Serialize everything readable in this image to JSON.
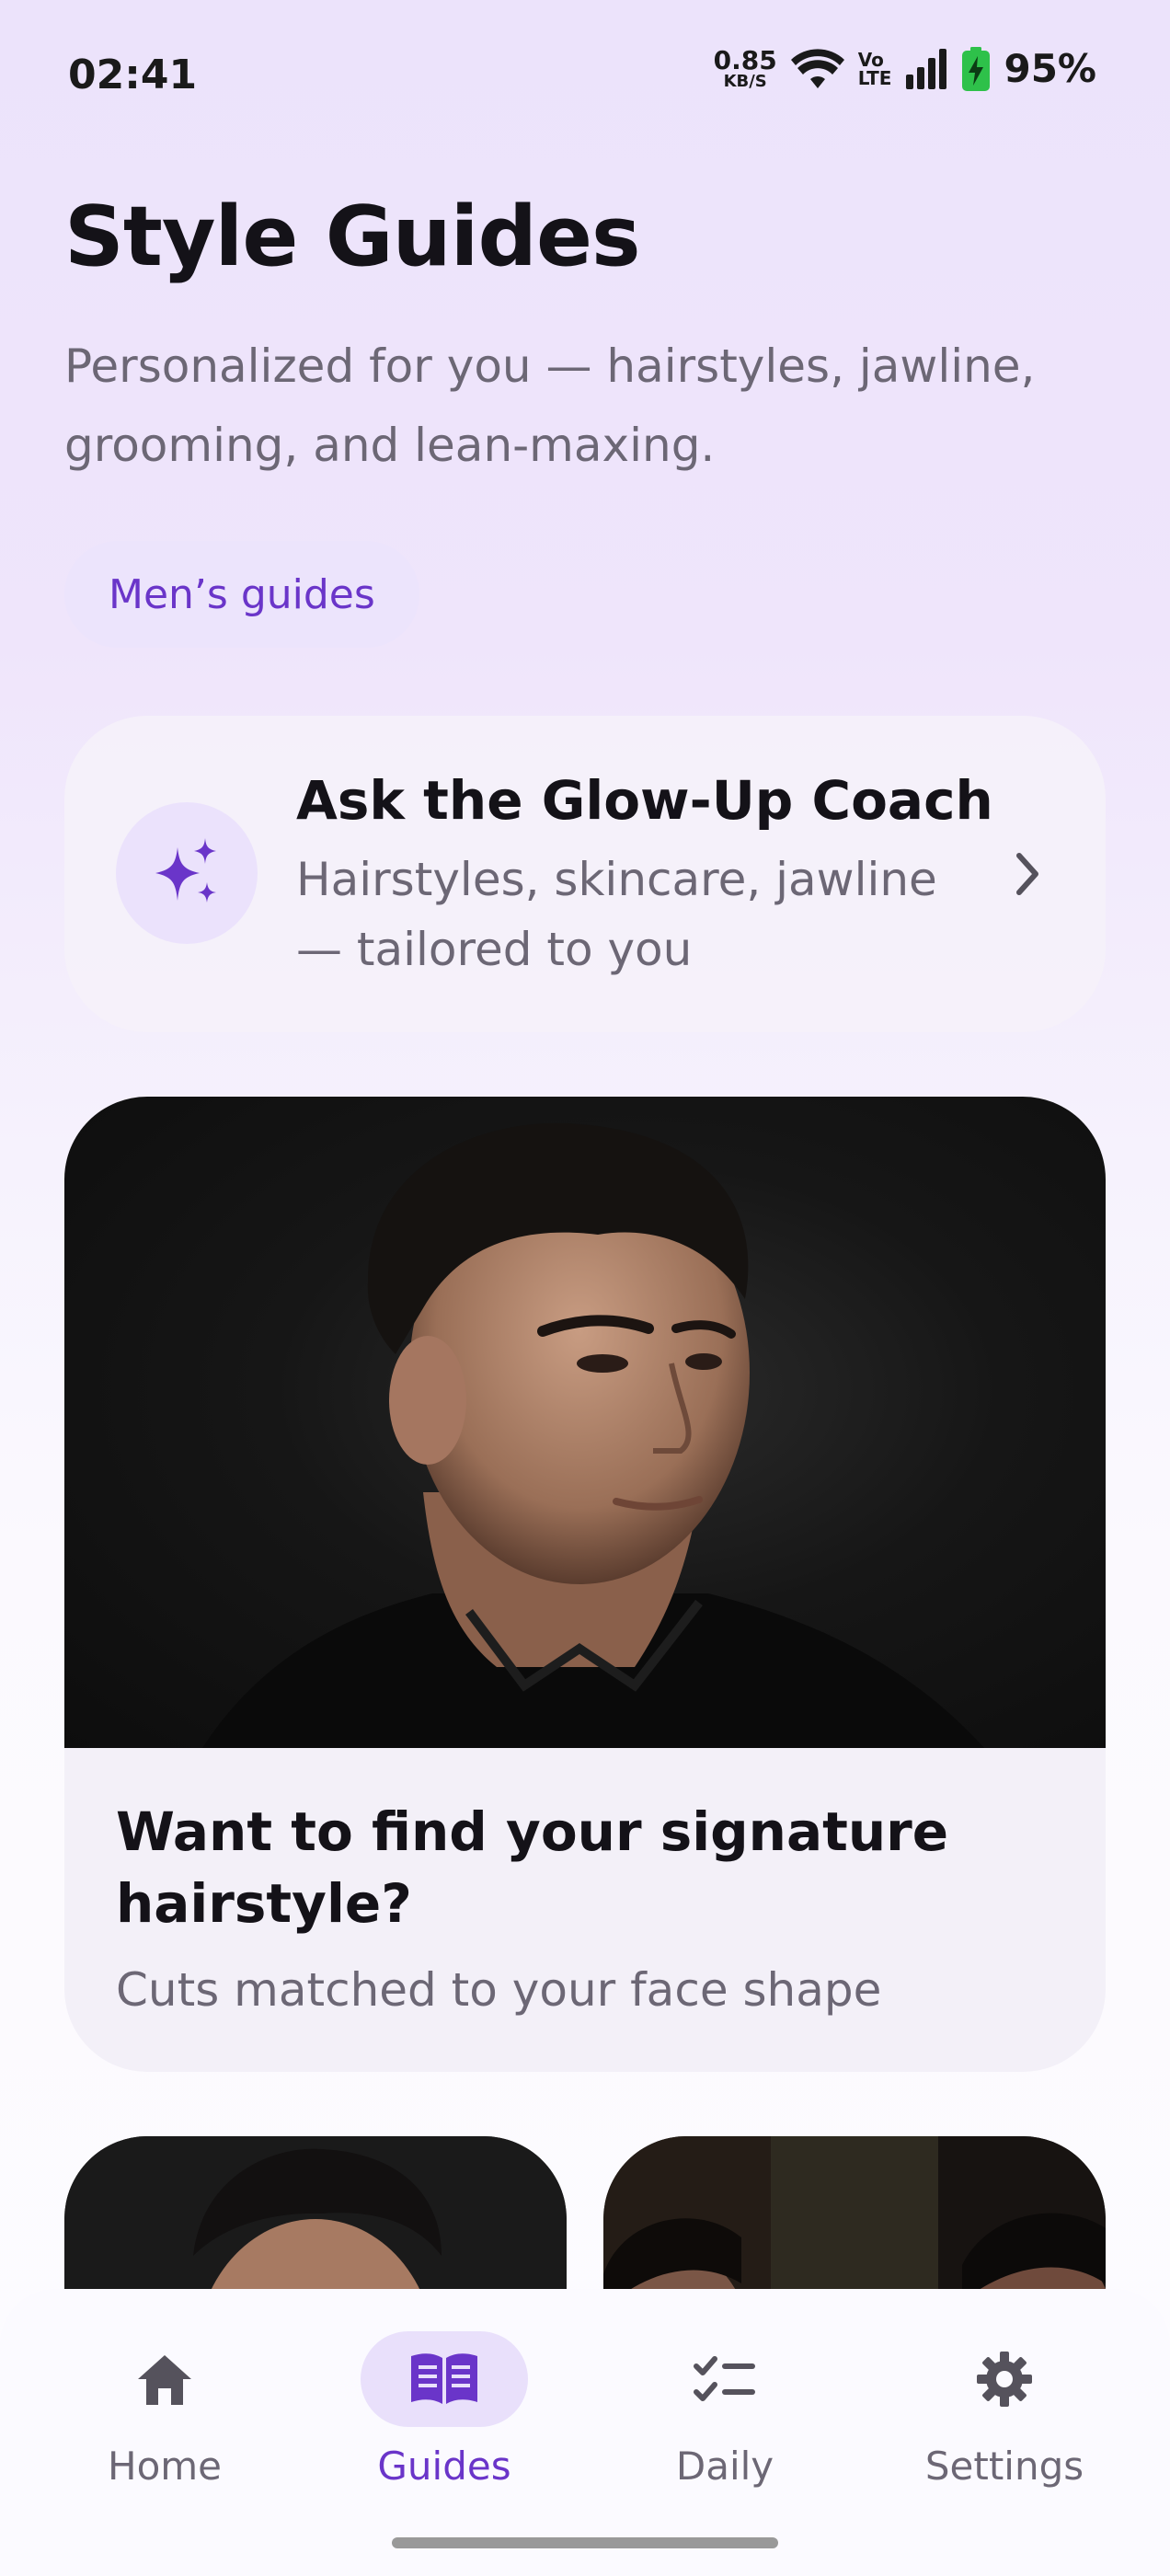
{
  "status_bar": {
    "time": "02:41",
    "net_speed_value": "0.85",
    "net_speed_unit": "KB/S",
    "volte_top": "Vo",
    "volte_bottom": "LTE",
    "battery": "95%"
  },
  "header": {
    "title": "Style Guides",
    "subtitle": "Personalized for you — hairstyles, jawline, grooming, and lean-maxing."
  },
  "filter_chip": {
    "label": "Men’s guides"
  },
  "coach_card": {
    "title": "Ask the Glow-Up Coach",
    "subtitle": "Hairstyles, skincare, jawline — tailored to you",
    "icon": "sparkles-icon"
  },
  "feature_card": {
    "title": "Want to find your signature hairstyle?",
    "subtitle": "Cuts matched to your face shape"
  },
  "bottom_nav": {
    "items": [
      {
        "label": "Home",
        "icon": "home-icon",
        "active": false
      },
      {
        "label": "Guides",
        "icon": "book-icon",
        "active": true
      },
      {
        "label": "Daily",
        "icon": "checklist-icon",
        "active": false
      },
      {
        "label": "Settings",
        "icon": "gear-icon",
        "active": false
      }
    ]
  },
  "colors": {
    "accent": "#6a35c9",
    "chip_bg": "#ece4fc",
    "muted_text": "#6c6775"
  }
}
